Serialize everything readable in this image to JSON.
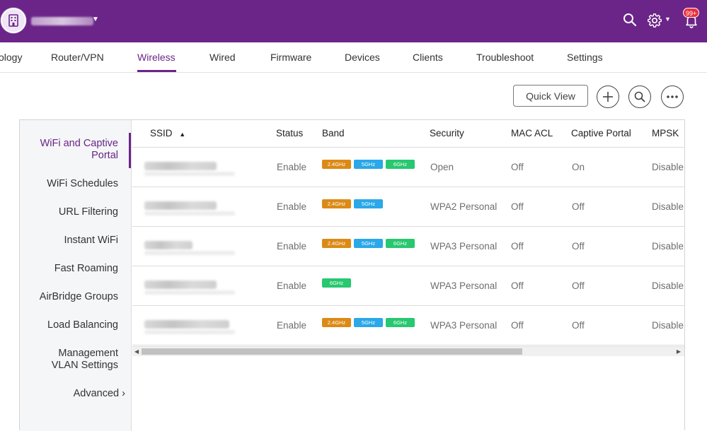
{
  "header": {
    "org_name": "",
    "notifications_badge": "99+",
    "colors": {
      "brand": "#6b2488",
      "badge": "#e8303c"
    }
  },
  "nav": {
    "items": [
      {
        "label": "ology"
      },
      {
        "label": "Router/VPN"
      },
      {
        "label": "Wireless"
      },
      {
        "label": "Wired"
      },
      {
        "label": "Firmware"
      },
      {
        "label": "Devices"
      },
      {
        "label": "Clients"
      },
      {
        "label": "Troubleshoot"
      },
      {
        "label": "Settings"
      }
    ],
    "active": "Wireless"
  },
  "toolbar": {
    "quick_view_label": "Quick View",
    "icons": [
      "plus-icon",
      "search-icon",
      "more-icon"
    ]
  },
  "subnav": {
    "items": [
      {
        "label": "WiFi and Captive Portal"
      },
      {
        "label": "WiFi Schedules"
      },
      {
        "label": "URL Filtering"
      },
      {
        "label": "Instant WiFi"
      },
      {
        "label": "Fast Roaming"
      },
      {
        "label": "AirBridge Groups"
      },
      {
        "label": "Load Balancing"
      },
      {
        "label": "Management VLAN Settings"
      },
      {
        "label": "Advanced"
      }
    ],
    "active": "WiFi and Captive Portal"
  },
  "table": {
    "columns": [
      "SSID",
      "Status",
      "Band",
      "Security",
      "MAC ACL",
      "Captive Portal",
      "MPSK"
    ],
    "sort_indicator": "▲",
    "rows": [
      {
        "status": "Enable",
        "bands": [
          "2.4GHz",
          "5GHz",
          "6GHz"
        ],
        "security": "Open",
        "mac_acl": "Off",
        "captive_portal": "On",
        "mpsk": "Disable"
      },
      {
        "status": "Enable",
        "bands": [
          "2.4GHz",
          "5GHz"
        ],
        "security": "WPA2 Personal",
        "mac_acl": "Off",
        "captive_portal": "Off",
        "mpsk": "Disable"
      },
      {
        "status": "Enable",
        "bands": [
          "2.4GHz",
          "5GHz",
          "6GHz"
        ],
        "security": "WPA3 Personal",
        "mac_acl": "Off",
        "captive_portal": "Off",
        "mpsk": "Disable"
      },
      {
        "status": "Enable",
        "bands": [
          "6GHz"
        ],
        "security": "WPA3 Personal",
        "mac_acl": "Off",
        "captive_portal": "Off",
        "mpsk": "Disable"
      },
      {
        "status": "Enable",
        "bands": [
          "2.4GHz",
          "5GHz",
          "6GHz"
        ],
        "security": "WPA3 Personal",
        "mac_acl": "Off",
        "captive_portal": "Off",
        "mpsk": "Disable"
      }
    ],
    "band_colors": {
      "2.4GHz": "#dc8a16",
      "5GHz": "#2aa8e8",
      "6GHz": "#27c86f"
    }
  }
}
